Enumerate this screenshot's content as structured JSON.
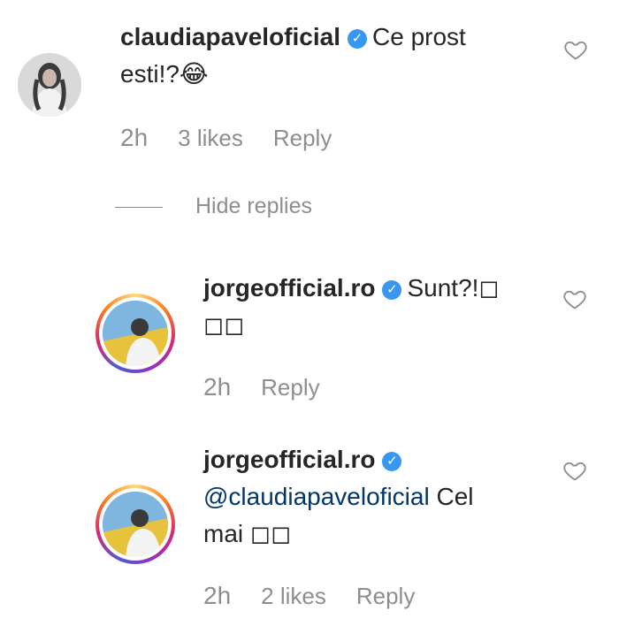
{
  "comments": [
    {
      "username": "claudiapaveloficial",
      "text_line1": "Ce prost",
      "text_line2": "esti!?😂",
      "time": "2h",
      "likes": "3 likes",
      "reply_label": "Reply"
    },
    {
      "username": "jorgeofficial.ro",
      "text_line1": "Sunt?!◻",
      "text_line2": "◻◻",
      "time": "2h",
      "reply_label": "Reply"
    },
    {
      "username": "jorgeofficial.ro",
      "mention": "@claudiapaveloficial",
      "text_line1": " Cel",
      "text_line2": "mai ◻◻",
      "time": "2h",
      "likes": "2 likes",
      "reply_label": "Reply"
    }
  ],
  "hide_replies_label": "Hide replies",
  "colors": {
    "verified": "#3897f0",
    "meta_gray": "#8e8e8e",
    "mention": "#00376b"
  },
  "icons": {
    "verified": "verified-badge-icon",
    "like": "heart-outline-icon"
  }
}
